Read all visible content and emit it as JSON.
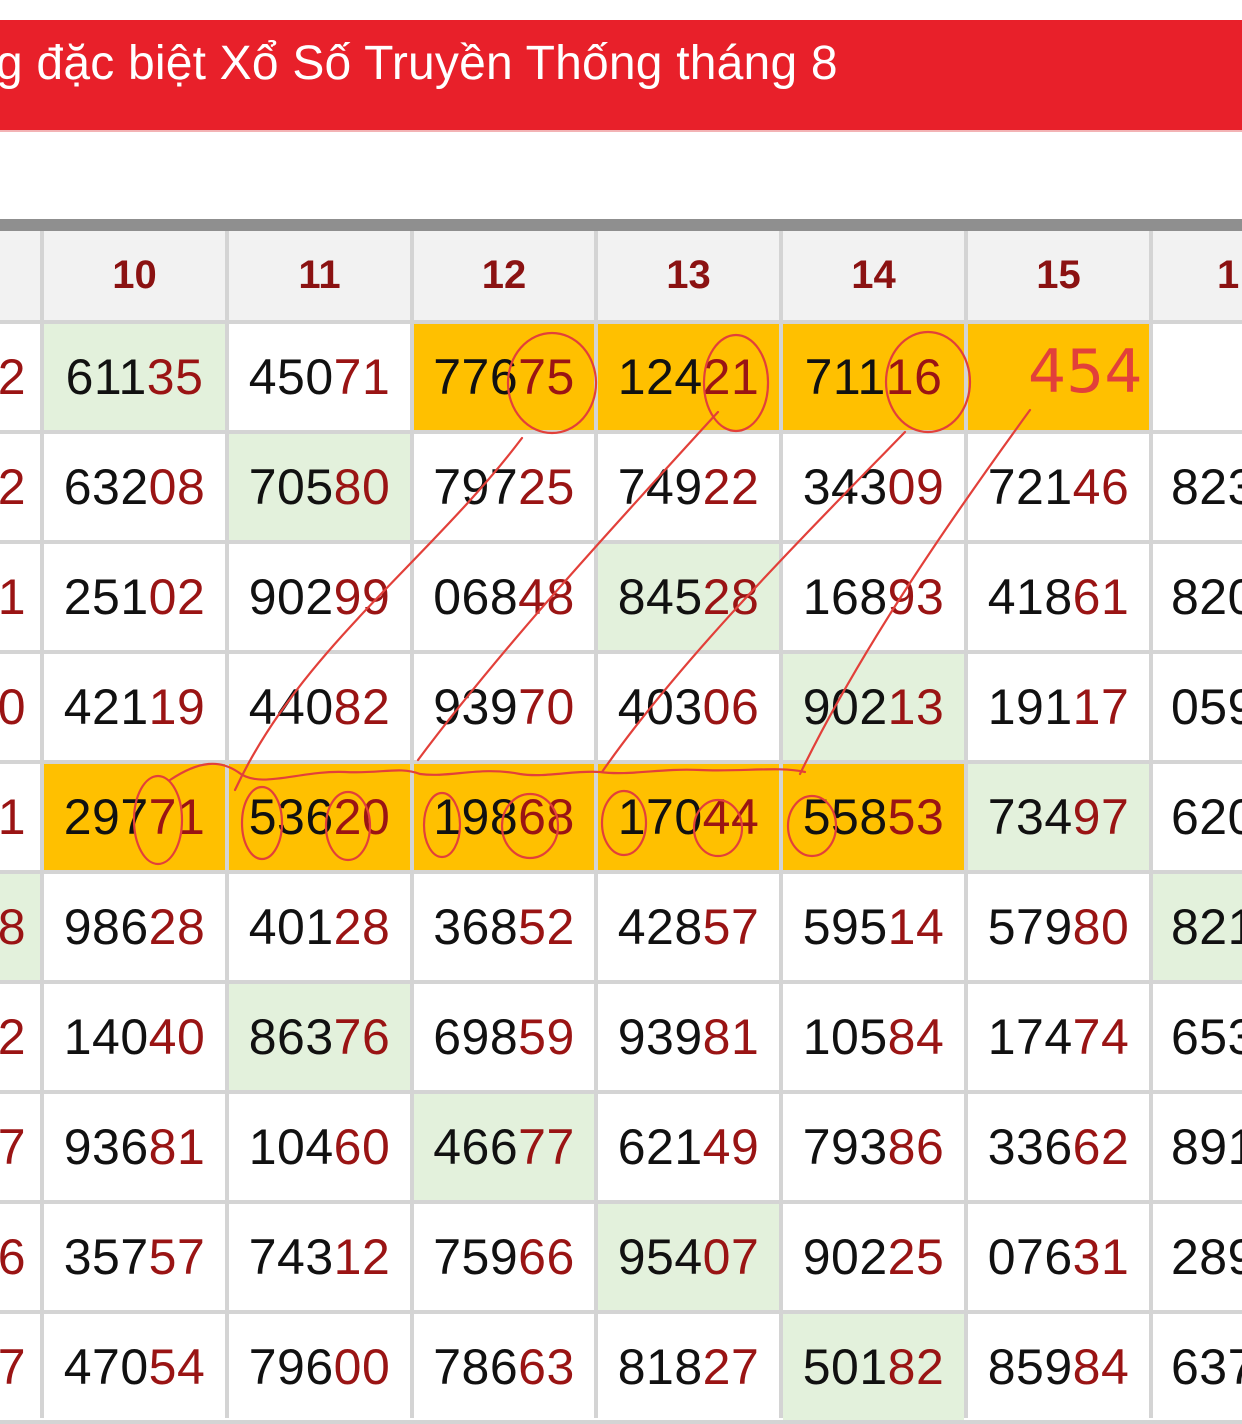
{
  "page_title": "g đặc biệt Xổ Số Truyền Thống tháng 8",
  "columns": [
    "",
    "10",
    "11",
    "12",
    "13",
    "14",
    "15",
    "1"
  ],
  "rows": [
    {
      "cells": [
        {
          "lead": "",
          "tail": "2",
          "bg": "white"
        },
        {
          "lead": "611",
          "tail": "35",
          "bg": "green"
        },
        {
          "lead": "450",
          "tail": "71",
          "bg": "white"
        },
        {
          "lead": "776",
          "tail": "75",
          "bg": "yellow"
        },
        {
          "lead": "124",
          "tail": "21",
          "bg": "yellow"
        },
        {
          "lead": "711",
          "tail": "16",
          "bg": "yellow"
        },
        {
          "lead": "",
          "tail": "",
          "bg": "yellow"
        },
        {
          "lead": "",
          "tail": "",
          "bg": "white"
        }
      ]
    },
    {
      "cells": [
        {
          "lead": "",
          "tail": "2",
          "bg": "white"
        },
        {
          "lead": "632",
          "tail": "08",
          "bg": "white"
        },
        {
          "lead": "705",
          "tail": "80",
          "bg": "green"
        },
        {
          "lead": "797",
          "tail": "25",
          "bg": "white"
        },
        {
          "lead": "749",
          "tail": "22",
          "bg": "white"
        },
        {
          "lead": "343",
          "tail": "09",
          "bg": "white"
        },
        {
          "lead": "721",
          "tail": "46",
          "bg": "white"
        },
        {
          "lead": "823",
          "tail": "",
          "bg": "white"
        }
      ]
    },
    {
      "cells": [
        {
          "lead": "",
          "tail": "1",
          "bg": "white"
        },
        {
          "lead": "251",
          "tail": "02",
          "bg": "white"
        },
        {
          "lead": "902",
          "tail": "99",
          "bg": "white"
        },
        {
          "lead": "068",
          "tail": "48",
          "bg": "white"
        },
        {
          "lead": "845",
          "tail": "28",
          "bg": "green"
        },
        {
          "lead": "168",
          "tail": "93",
          "bg": "white"
        },
        {
          "lead": "418",
          "tail": "61",
          "bg": "white"
        },
        {
          "lead": "820",
          "tail": "",
          "bg": "white"
        }
      ]
    },
    {
      "cells": [
        {
          "lead": "",
          "tail": "0",
          "bg": "white"
        },
        {
          "lead": "421",
          "tail": "19",
          "bg": "white"
        },
        {
          "lead": "440",
          "tail": "82",
          "bg": "white"
        },
        {
          "lead": "939",
          "tail": "70",
          "bg": "white"
        },
        {
          "lead": "403",
          "tail": "06",
          "bg": "white"
        },
        {
          "lead": "902",
          "tail": "13",
          "bg": "green"
        },
        {
          "lead": "191",
          "tail": "17",
          "bg": "white"
        },
        {
          "lead": "059",
          "tail": "",
          "bg": "white"
        }
      ]
    },
    {
      "cells": [
        {
          "lead": "",
          "tail": "1",
          "bg": "white"
        },
        {
          "lead": "297",
          "tail": "71",
          "bg": "yellow"
        },
        {
          "lead": "536",
          "tail": "20",
          "bg": "yellow"
        },
        {
          "lead": "198",
          "tail": "68",
          "bg": "yellow"
        },
        {
          "lead": "170",
          "tail": "44",
          "bg": "yellow"
        },
        {
          "lead": "558",
          "tail": "53",
          "bg": "yellow"
        },
        {
          "lead": "734",
          "tail": "97",
          "bg": "green"
        },
        {
          "lead": "620",
          "tail": "",
          "bg": "white"
        }
      ]
    },
    {
      "cells": [
        {
          "lead": "",
          "tail": "8",
          "bg": "green"
        },
        {
          "lead": "986",
          "tail": "28",
          "bg": "white"
        },
        {
          "lead": "401",
          "tail": "28",
          "bg": "white"
        },
        {
          "lead": "368",
          "tail": "52",
          "bg": "white"
        },
        {
          "lead": "428",
          "tail": "57",
          "bg": "white"
        },
        {
          "lead": "595",
          "tail": "14",
          "bg": "white"
        },
        {
          "lead": "579",
          "tail": "80",
          "bg": "white"
        },
        {
          "lead": "821",
          "tail": "",
          "bg": "green"
        }
      ]
    },
    {
      "cells": [
        {
          "lead": "",
          "tail": "2",
          "bg": "white"
        },
        {
          "lead": "140",
          "tail": "40",
          "bg": "white"
        },
        {
          "lead": "863",
          "tail": "76",
          "bg": "green"
        },
        {
          "lead": "698",
          "tail": "59",
          "bg": "white"
        },
        {
          "lead": "939",
          "tail": "81",
          "bg": "white"
        },
        {
          "lead": "105",
          "tail": "84",
          "bg": "white"
        },
        {
          "lead": "174",
          "tail": "74",
          "bg": "white"
        },
        {
          "lead": "653",
          "tail": "",
          "bg": "white"
        }
      ]
    },
    {
      "cells": [
        {
          "lead": "",
          "tail": "7",
          "bg": "white"
        },
        {
          "lead": "936",
          "tail": "81",
          "bg": "white"
        },
        {
          "lead": "104",
          "tail": "60",
          "bg": "white"
        },
        {
          "lead": "466",
          "tail": "77",
          "bg": "green"
        },
        {
          "lead": "621",
          "tail": "49",
          "bg": "white"
        },
        {
          "lead": "793",
          "tail": "86",
          "bg": "white"
        },
        {
          "lead": "336",
          "tail": "62",
          "bg": "white"
        },
        {
          "lead": "891",
          "tail": "",
          "bg": "white"
        }
      ]
    },
    {
      "cells": [
        {
          "lead": "",
          "tail": "6",
          "bg": "white"
        },
        {
          "lead": "357",
          "tail": "57",
          "bg": "white"
        },
        {
          "lead": "743",
          "tail": "12",
          "bg": "white"
        },
        {
          "lead": "759",
          "tail": "66",
          "bg": "white"
        },
        {
          "lead": "954",
          "tail": "07",
          "bg": "green"
        },
        {
          "lead": "902",
          "tail": "25",
          "bg": "white"
        },
        {
          "lead": "076",
          "tail": "31",
          "bg": "white"
        },
        {
          "lead": "289",
          "tail": "",
          "bg": "white"
        }
      ]
    },
    {
      "cells": [
        {
          "lead": "",
          "tail": "7",
          "bg": "white"
        },
        {
          "lead": "470",
          "tail": "54",
          "bg": "white"
        },
        {
          "lead": "796",
          "tail": "00",
          "bg": "white"
        },
        {
          "lead": "786",
          "tail": "63",
          "bg": "white"
        },
        {
          "lead": "818",
          "tail": "27",
          "bg": "white"
        },
        {
          "lead": "501",
          "tail": "82",
          "bg": "green"
        },
        {
          "lead": "859",
          "tail": "84",
          "bg": "white"
        },
        {
          "lead": "637",
          "tail": "",
          "bg": "white"
        }
      ]
    }
  ],
  "handwritten_note": "454",
  "colors": {
    "banner": "#e8202a",
    "highlight_yellow": "#ffc000",
    "highlight_green": "#e3f1dc",
    "tail_digits": "#9a1414",
    "header_text": "#8b1212",
    "ink": "#e2403a"
  }
}
